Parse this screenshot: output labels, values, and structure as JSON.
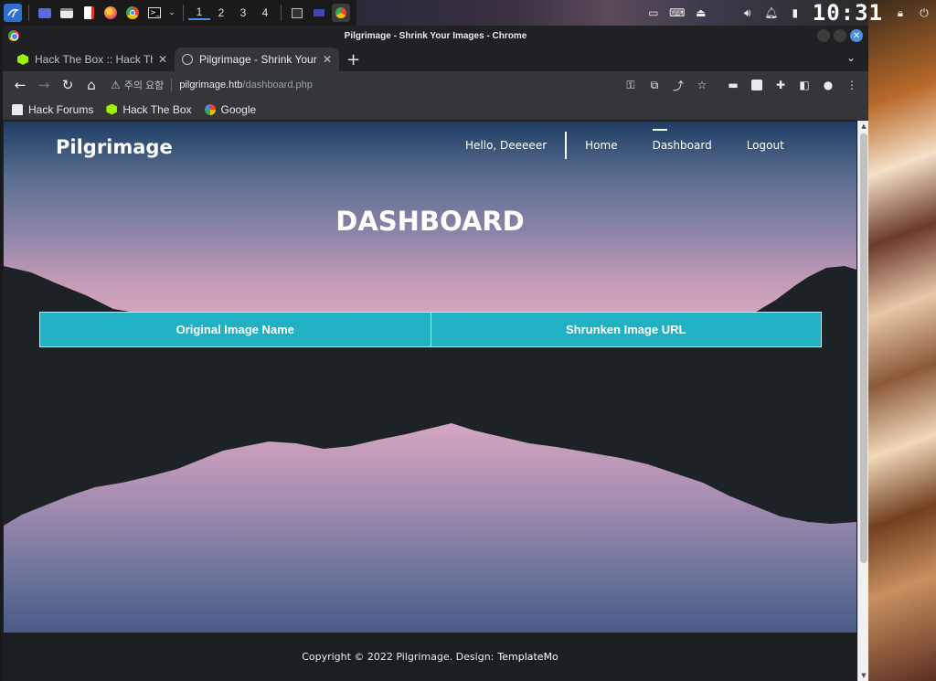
{
  "taskbar": {
    "workspaces": [
      "1",
      "2",
      "3",
      "4"
    ],
    "clock": "10:31",
    "icons": [
      "kali-menu-icon",
      "desktop-icon",
      "file-manager-icon",
      "text-editor-icon",
      "firefox-icon",
      "chrome-icon",
      "terminal-icon",
      "chevron-down-icon"
    ],
    "tray_icons": [
      "display-icon",
      "keyboard-icon",
      "vpn-icon",
      "volume-icon",
      "bell-icon",
      "battery-icon",
      "lock-icon",
      "power-icon"
    ]
  },
  "window": {
    "title": "Pilgrimage - Shrink Your Images - Chrome"
  },
  "tabs": [
    {
      "label": "Hack The Box :: Hack The B",
      "favicon": "hackthebox-icon",
      "active": false
    },
    {
      "label": "Pilgrimage - Shrink Your I",
      "favicon": "globe-icon",
      "active": true
    }
  ],
  "toolbar": {
    "warning_text": "주의 요함",
    "url_host": "pilgrimage.htb",
    "url_path": "/dashboard.php"
  },
  "bookmarks": [
    {
      "label": "Hack Forums",
      "icon": "hackforums-icon"
    },
    {
      "label": "Hack The Box",
      "icon": "hackthebox-icon"
    },
    {
      "label": "Google",
      "icon": "google-icon"
    }
  ],
  "site": {
    "logo": "Pilgrimage",
    "greeting": "Hello, Deeeeer",
    "nav": [
      {
        "label": "Home",
        "active": false
      },
      {
        "label": "Dashboard",
        "active": true
      },
      {
        "label": "Logout",
        "active": false
      }
    ],
    "heading": "DASHBOARD",
    "table_headers": [
      "Original Image Name",
      "Shrunken Image URL"
    ],
    "footer_text": "Copyright © 2022 Pilgrimage. Design:",
    "footer_brand": "TemplateMo"
  },
  "colors": {
    "table_header_bg": "#21b1c3",
    "accent": "#4a90e2"
  }
}
